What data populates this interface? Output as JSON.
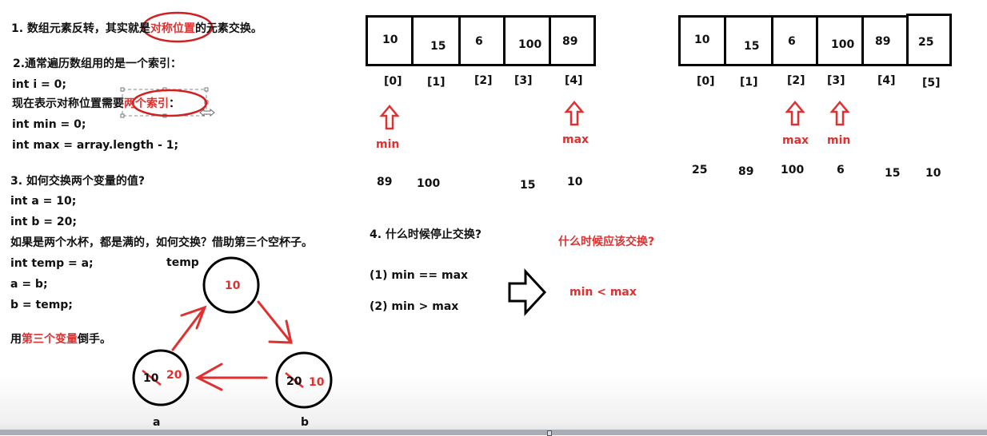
{
  "left": {
    "line1": {
      "prefix": "1. 数组元素反转，其实就是",
      "highlight": "对称位置",
      "suffix": "的元素交换。"
    },
    "line2": "2.通常遍历数组用的是一个索引：",
    "line3": "int i = 0;",
    "line4": {
      "prefix": "现在表示对称位置需要",
      "highlight": "两个索引",
      "suffix": "："
    },
    "line5": "int min = 0;",
    "line6": "int max = array.length - 1;",
    "line7": "3. 如何交换两个变量的值?",
    "line8": "int a = 10;",
    "line9": "int b = 20;",
    "line10": "如果是两个水杯，都是满的，如何交换？借助第三个空杯子。",
    "line11": "int temp = a;",
    "line12": "a = b;",
    "line13": "b = temp;",
    "line14": {
      "prefix": "用",
      "highlight": "第三个变量",
      "suffix": "倒手。"
    }
  },
  "diagram": {
    "temp_label": "temp",
    "temp_value": "10",
    "a_label": "a",
    "a_old": "10",
    "a_new": "20",
    "b_label": "b",
    "b_old": "20",
    "b_new": "10"
  },
  "array1": {
    "values": [
      "10",
      "15",
      "6",
      "100",
      "89"
    ],
    "indices": [
      "[0]",
      "[1]",
      "[2]",
      "[3]",
      "[4]"
    ],
    "min_label": "min",
    "max_label": "max",
    "reversed": [
      "89",
      "100",
      "15",
      "10"
    ]
  },
  "array2": {
    "values": [
      "10",
      "15",
      "6",
      "100",
      "89",
      "25"
    ],
    "indices": [
      "[0]",
      "[1]",
      "[2]",
      "[3]",
      "[4]",
      "[5]"
    ],
    "max_label": "max",
    "min_label": "min",
    "reversed": [
      "25",
      "89",
      "100",
      "6",
      "15",
      "10"
    ]
  },
  "stop": {
    "title": "4. 什么时候停止交换?",
    "cond1": "(1) min == max",
    "cond2": "(2) min > max",
    "question": "什么时候应该交换?",
    "answer": "min < max"
  },
  "colors": {
    "accent": "#e03030",
    "text": "#111111"
  }
}
